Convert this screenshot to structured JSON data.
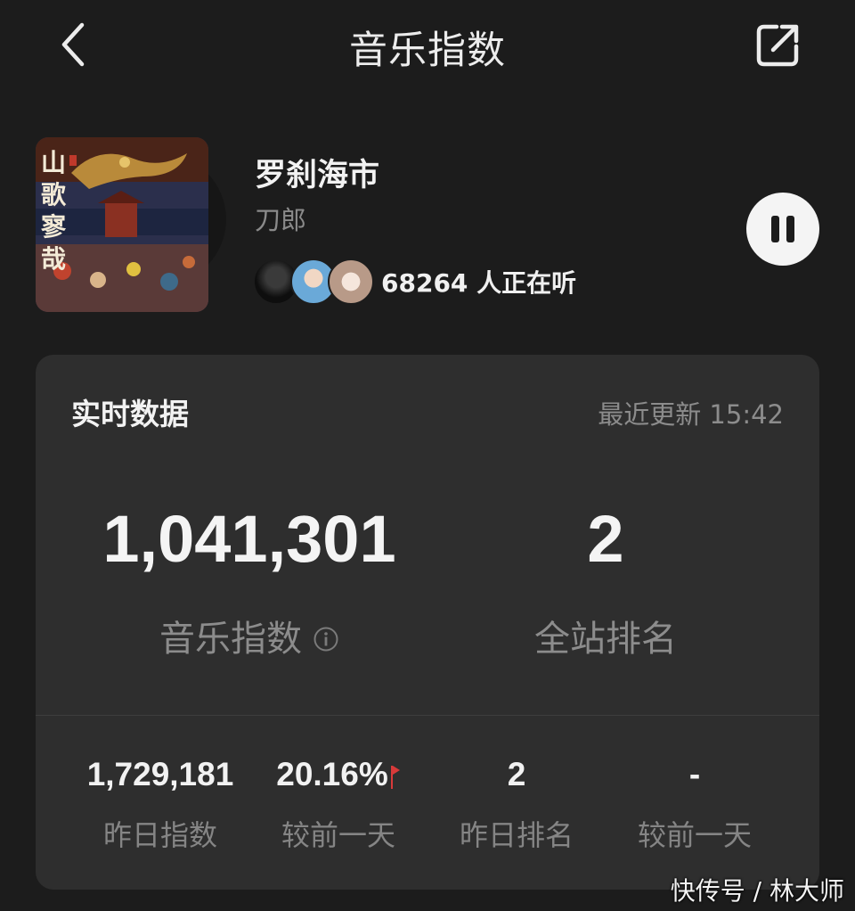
{
  "header": {
    "title": "音乐指数"
  },
  "song": {
    "title": "罗刹海市",
    "artist": "刀郎",
    "cover_text": "山歌寥哉",
    "listeners_text": "68264 人正在听"
  },
  "realtime": {
    "title": "实时数据",
    "updated": "最近更新 15:42",
    "music_index_value": "1,041,301",
    "music_index_label": "音乐指数",
    "site_rank_value": "2",
    "site_rank_label": "全站排名"
  },
  "stats": [
    {
      "value": "1,729,181",
      "label": "昨日指数"
    },
    {
      "value": "20.16%",
      "label": "较前一天"
    },
    {
      "value": "2",
      "label": "昨日排名"
    },
    {
      "value": "-",
      "label": "较前一天"
    }
  ],
  "watermark": "快传号 / 林大师",
  "colors": {
    "background": "#1c1c1c",
    "card": "#2e2e2e",
    "up_flag": "#d83a3a"
  },
  "icons": [
    "back-arrow-icon",
    "share-icon",
    "pause-icon",
    "info-icon",
    "red-flag-icon"
  ]
}
